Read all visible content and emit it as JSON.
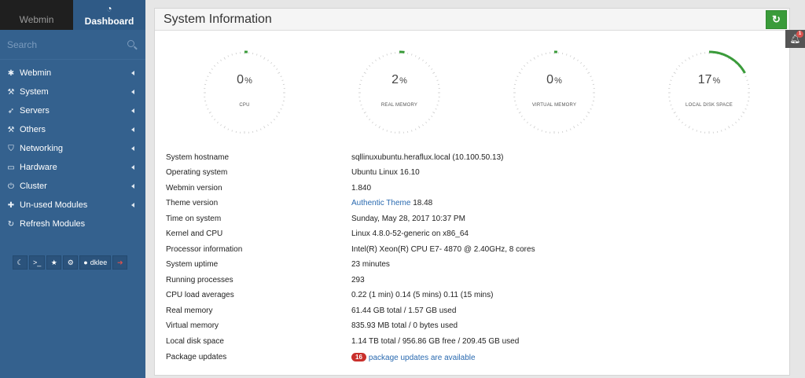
{
  "sidebar": {
    "tab_webmin": "Webmin",
    "tab_dashboard": "Dashboard",
    "search_placeholder": "Search",
    "items": [
      {
        "label": "Webmin",
        "icon": "gear-icon"
      },
      {
        "label": "System",
        "icon": "wrench-icon"
      },
      {
        "label": "Servers",
        "icon": "rocket-icon"
      },
      {
        "label": "Others",
        "icon": "hammer-icon"
      },
      {
        "label": "Networking",
        "icon": "shield-icon"
      },
      {
        "label": "Hardware",
        "icon": "hdd-icon"
      },
      {
        "label": "Cluster",
        "icon": "power-icon"
      },
      {
        "label": "Un-used Modules",
        "icon": "puzzle-icon"
      },
      {
        "label": "Refresh Modules",
        "icon": "refresh-icon"
      }
    ],
    "user": "dklee"
  },
  "panel": {
    "title": "System Information"
  },
  "gauges": [
    {
      "value": "0",
      "unit": "%",
      "label": "CPU",
      "percent": 0
    },
    {
      "value": "2",
      "unit": "%",
      "label": "REAL MEMORY",
      "percent": 2
    },
    {
      "value": "0",
      "unit": "%",
      "label": "VIRTUAL MEMORY",
      "percent": 0
    },
    {
      "value": "17",
      "unit": "%",
      "label": "LOCAL DISK SPACE",
      "percent": 17
    }
  ],
  "info": {
    "hostname": {
      "key": "System hostname",
      "value": "sqllinuxubuntu.heraflux.local (10.100.50.13)"
    },
    "os": {
      "key": "Operating system",
      "value": "Ubuntu Linux 16.10"
    },
    "webmin_version": {
      "key": "Webmin version",
      "value": "1.840"
    },
    "theme_version": {
      "key": "Theme version",
      "link": "Authentic Theme",
      "value": " 18.48"
    },
    "time": {
      "key": "Time on system",
      "value": "Sunday, May 28, 2017 10:37 PM"
    },
    "kernel": {
      "key": "Kernel and CPU",
      "value": "Linux 4.8.0-52-generic on x86_64"
    },
    "processor": {
      "key": "Processor information",
      "value": "Intel(R) Xeon(R) CPU E7- 4870 @ 2.40GHz, 8 cores"
    },
    "uptime": {
      "key": "System uptime",
      "value": "23 minutes"
    },
    "processes": {
      "key": "Running processes",
      "value": "293"
    },
    "load": {
      "key": "CPU load averages",
      "value": "0.22 (1 min) 0.14 (5 mins) 0.11 (15 mins)"
    },
    "real_memory": {
      "key": "Real memory",
      "value": "61.44 GB total / 1.57 GB used"
    },
    "virtual_memory": {
      "key": "Virtual memory",
      "value": "835.93 MB total / 0 bytes used"
    },
    "disk": {
      "key": "Local disk space",
      "value": "1.14 TB total / 956.86 GB free / 209.45 GB used"
    },
    "updates": {
      "key": "Package updates",
      "count": "16",
      "value": "package updates are available"
    }
  },
  "notifications": {
    "count": "1"
  },
  "colors": {
    "sidebar": "#34618e",
    "accent": "#3a9b3a",
    "link": "#2a6ab0",
    "badge": "#c9302c"
  }
}
